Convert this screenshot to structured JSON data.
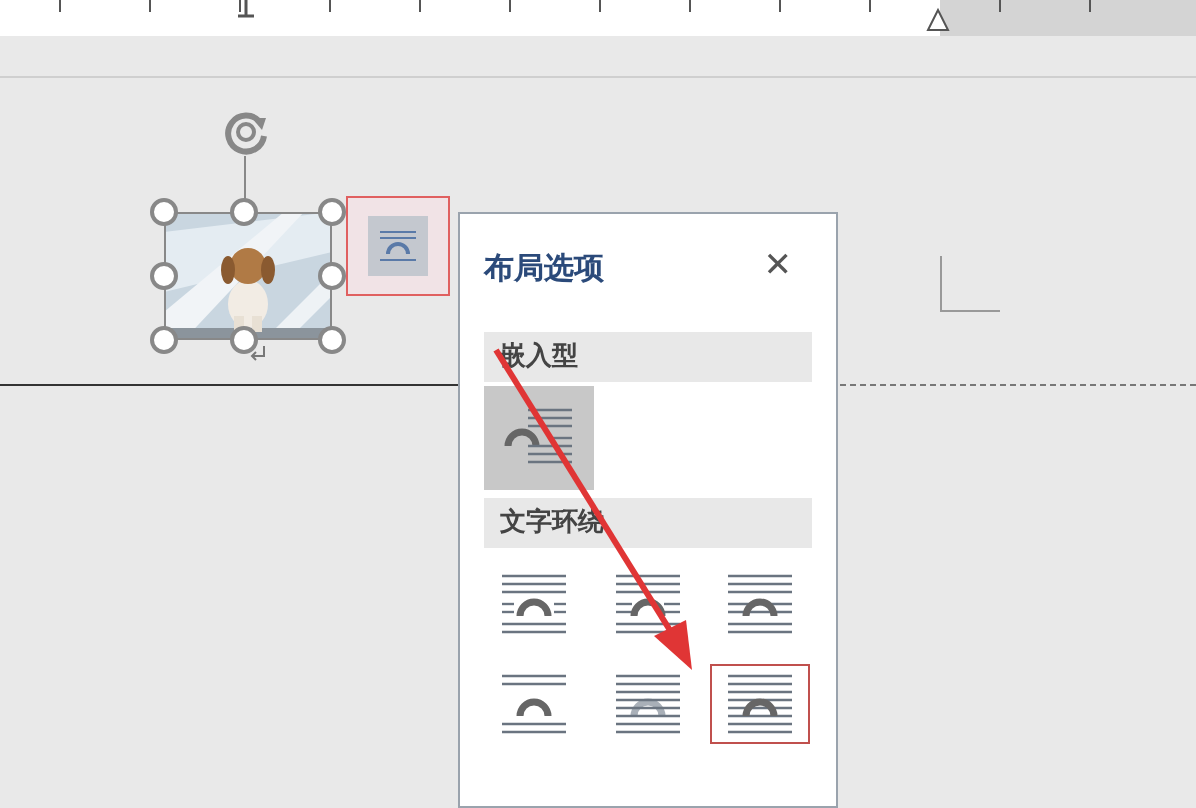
{
  "popup": {
    "title": "布局选项",
    "close": "✕",
    "sections": [
      {
        "header": "嵌入型",
        "options": [
          {
            "kind": "inline",
            "selected": true,
            "hovered": false
          }
        ]
      },
      {
        "header": "文字环绕",
        "options": [
          {
            "kind": "square",
            "selected": false,
            "hovered": false
          },
          {
            "kind": "tight",
            "selected": false,
            "hovered": false
          },
          {
            "kind": "through",
            "selected": false,
            "hovered": false
          },
          {
            "kind": "topbottom",
            "selected": false,
            "hovered": false
          },
          {
            "kind": "behind",
            "selected": false,
            "hovered": false
          },
          {
            "kind": "front",
            "selected": false,
            "hovered": true
          }
        ]
      }
    ]
  }
}
